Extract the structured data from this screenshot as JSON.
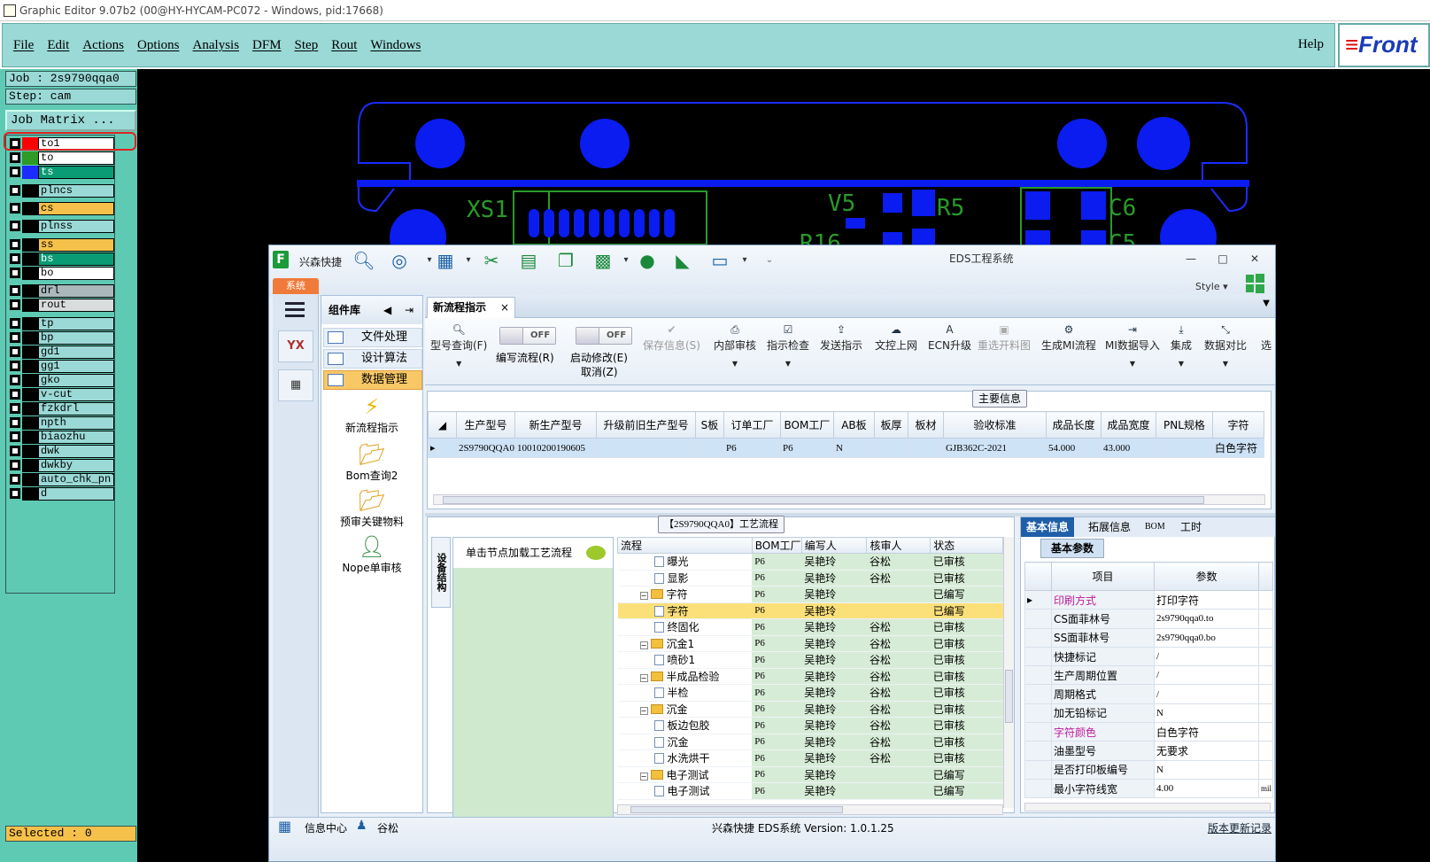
{
  "window": {
    "title": "Graphic Editor 9.07b2 (00@HY-HYCAM-PC072 - Windows, pid:17668)"
  },
  "menu": {
    "items": [
      "File",
      "Edit",
      "Actions",
      "Options",
      "Analysis",
      "DFM",
      "Step",
      "Rout",
      "Windows"
    ],
    "help": "Help",
    "logo": "Front"
  },
  "job": {
    "job_label": "Job : 2s9790qqa0",
    "step_label": "Step: cam",
    "matrix_button": "Job Matrix ...",
    "selected": "Selected : 0"
  },
  "layers": [
    {
      "name": "to1",
      "color": "#ff0000",
      "bg": "#ffffff"
    },
    {
      "name": "to",
      "color": "#2e9a28",
      "bg": "#ffffff"
    },
    {
      "name": "ts",
      "color": "#1a2cff",
      "bg": "#0a9b74"
    },
    {
      "name": "plncs",
      "color": "#000000",
      "bg": "#9ad9d6"
    },
    {
      "name": "cs",
      "color": "#000000",
      "bg": "#f6c14a"
    },
    {
      "name": "plnss",
      "color": "#000000",
      "bg": "#9ad9d6"
    },
    {
      "name": "ss",
      "color": "#000000",
      "bg": "#f6c14a"
    },
    {
      "name": "bs",
      "color": "#000000",
      "bg": "#0a9b74"
    },
    {
      "name": "bo",
      "color": "#000000",
      "bg": "#ffffff"
    },
    {
      "name": "drl",
      "color": "#000000",
      "bg": "#aab8bc"
    },
    {
      "name": "rout",
      "color": "#000000",
      "bg": "#d8dcdc"
    },
    {
      "name": "tp",
      "color": "#000000",
      "bg": "#9ad9d6"
    },
    {
      "name": "bp",
      "color": "#000000",
      "bg": "#9ad9d6"
    },
    {
      "name": "gd1",
      "color": "#000000",
      "bg": "#9ad9d6"
    },
    {
      "name": "gg1",
      "color": "#000000",
      "bg": "#9ad9d6"
    },
    {
      "name": "gko",
      "color": "#000000",
      "bg": "#9ad9d6"
    },
    {
      "name": "v-cut",
      "color": "#000000",
      "bg": "#9ad9d6"
    },
    {
      "name": "fzkdrl",
      "color": "#000000",
      "bg": "#9ad9d6"
    },
    {
      "name": "npth",
      "color": "#000000",
      "bg": "#9ad9d6"
    },
    {
      "name": "biaozhu",
      "color": "#000000",
      "bg": "#9ad9d6"
    },
    {
      "name": "dwk",
      "color": "#000000",
      "bg": "#9ad9d6"
    },
    {
      "name": "dwkby",
      "color": "#000000",
      "bg": "#9ad9d6"
    },
    {
      "name": "auto_chk_pnl",
      "color": "#000000",
      "bg": "#9ad9d6"
    },
    {
      "name": "d",
      "color": "#000000",
      "bg": "#9ad9d6"
    }
  ],
  "pcb": {
    "labels": [
      "XS1",
      "V5",
      "R5",
      "C6",
      "R16",
      "C5"
    ],
    "colors": {
      "pad": "#0a1cf0",
      "silk": "#2a9a2a",
      "outline": "#1a2cff"
    }
  },
  "eds": {
    "brand": "兴森快捷",
    "title": "EDS工程系统",
    "sys_tab": "系统",
    "style_label": "Style",
    "window_controls": [
      "—",
      "□",
      "✕"
    ],
    "nav_icons": [
      "menu-icon",
      "yx-icon",
      "calculator-icon"
    ],
    "component_lib": {
      "title": "组件库",
      "items": [
        "文件处理",
        "设计算法",
        "数据管理"
      ],
      "big": [
        {
          "label": "新流程指示",
          "icon": "⚡"
        },
        {
          "label": "Bom查询2",
          "icon": "📂"
        },
        {
          "label": "预审关键物料",
          "icon": "📂"
        },
        {
          "label": "Nope单审核",
          "icon": "👤"
        }
      ]
    },
    "tab": {
      "label": "新流程指示",
      "close": "×"
    },
    "ribbon": {
      "query": "型号查询(F)",
      "toggle1": {
        "state": "OFF",
        "label": "编写流程(R)"
      },
      "toggle2": {
        "state": "OFF",
        "label": "启动修改(E)",
        "sub": "取消(Z)"
      },
      "buttons": [
        "保存信息(S)",
        "内部审核",
        "指示检查",
        "发送指示",
        "文控上网",
        "ECN升级",
        "重选开料图",
        "生成MI流程",
        "MI数据导入",
        "集成",
        "数据对比",
        "选"
      ]
    },
    "main_info": {
      "caption": "主要信息",
      "headers": [
        "生产型号",
        "新生产型号",
        "升级前旧生产型号",
        "S板",
        "订单工厂",
        "BOM工厂",
        "AB板",
        "板厚",
        "板材",
        "验收标准",
        "成品长度",
        "成品宽度",
        "PNL规格",
        "字符"
      ],
      "row": [
        "2S9790QQA0",
        "10010200190605",
        "",
        "",
        "P6",
        "P6",
        "N",
        "",
        "",
        "GJB362C-2021",
        "54.000",
        "43.000",
        "",
        "白色字符"
      ]
    },
    "process": {
      "caption": "【2S9790QQA0】工艺流程",
      "vtab": "设备结构",
      "tip": "单击节点加载工艺流程",
      "headers": [
        "流程",
        "BOM工厂",
        "编写人",
        "核审人",
        "状态"
      ],
      "rows": [
        {
          "name": "曝光",
          "level": 2,
          "type": "file",
          "bom": "P6",
          "writer": "吴艳玲",
          "reviewer": "谷松",
          "status": "已审核"
        },
        {
          "name": "显影",
          "level": 2,
          "type": "file",
          "bom": "P6",
          "writer": "吴艳玲",
          "reviewer": "谷松",
          "status": "已审核"
        },
        {
          "name": "字符",
          "level": 1,
          "type": "folder",
          "bom": "P6",
          "writer": "吴艳玲",
          "reviewer": "",
          "status": "已编写"
        },
        {
          "name": "字符",
          "level": 2,
          "type": "file",
          "bom": "P6",
          "writer": "吴艳玲",
          "reviewer": "",
          "status": "已编写",
          "highlight": true
        },
        {
          "name": "终固化",
          "level": 2,
          "type": "file",
          "bom": "P6",
          "writer": "吴艳玲",
          "reviewer": "谷松",
          "status": "已审核"
        },
        {
          "name": "沉金1",
          "level": 1,
          "type": "folder",
          "bom": "P6",
          "writer": "吴艳玲",
          "reviewer": "谷松",
          "status": "已审核"
        },
        {
          "name": "喷砂1",
          "level": 2,
          "type": "file",
          "bom": "P6",
          "writer": "吴艳玲",
          "reviewer": "谷松",
          "status": "已审核"
        },
        {
          "name": "半成品检验",
          "level": 1,
          "type": "folder",
          "bom": "P6",
          "writer": "吴艳玲",
          "reviewer": "谷松",
          "status": "已审核"
        },
        {
          "name": "半检",
          "level": 2,
          "type": "file",
          "bom": "P6",
          "writer": "吴艳玲",
          "reviewer": "谷松",
          "status": "已审核"
        },
        {
          "name": "沉金",
          "level": 1,
          "type": "folder",
          "bom": "P6",
          "writer": "吴艳玲",
          "reviewer": "谷松",
          "status": "已审核"
        },
        {
          "name": "板边包胶",
          "level": 2,
          "type": "file",
          "bom": "P6",
          "writer": "吴艳玲",
          "reviewer": "谷松",
          "status": "已审核"
        },
        {
          "name": "沉金",
          "level": 2,
          "type": "file",
          "bom": "P6",
          "writer": "吴艳玲",
          "reviewer": "谷松",
          "status": "已审核"
        },
        {
          "name": "水洗烘干",
          "level": 2,
          "type": "file",
          "bom": "P6",
          "writer": "吴艳玲",
          "reviewer": "谷松",
          "status": "已审核"
        },
        {
          "name": "电子测试",
          "level": 1,
          "type": "folder",
          "bom": "P6",
          "writer": "吴艳玲",
          "reviewer": "",
          "status": "已编写"
        },
        {
          "name": "电子测试",
          "level": 2,
          "type": "file",
          "bom": "P6",
          "writer": "吴艳玲",
          "reviewer": "",
          "status": "已编写"
        }
      ]
    },
    "basic": {
      "tabs": [
        "基本信息",
        "拓展信息",
        "BOM",
        "工时"
      ],
      "sub_tab": "基本参数",
      "headers": [
        "项目",
        "参数"
      ],
      "rows": [
        {
          "k": "印刷方式",
          "v": "打印字符",
          "pink": true
        },
        {
          "k": "CS面菲林号",
          "v": "2s9790qqa0.to"
        },
        {
          "k": "SS面菲林号",
          "v": "2s9790qqa0.bo"
        },
        {
          "k": "快捷标记",
          "v": "/"
        },
        {
          "k": "生产周期位置",
          "v": "/"
        },
        {
          "k": "周期格式",
          "v": "/"
        },
        {
          "k": "加无铅标记",
          "v": "N"
        },
        {
          "k": "字符颜色",
          "v": "白色字符",
          "pink": true
        },
        {
          "k": "油墨型号",
          "v": "无要求"
        },
        {
          "k": "是否打印板编号",
          "v": "N"
        },
        {
          "k": "最小字符线宽",
          "v": "4.00"
        }
      ],
      "unit": "mil"
    },
    "status": {
      "info_center": "信息中心",
      "user": "谷松",
      "version": "兴森快捷 EDS系统 Version: 1.0.1.25",
      "update_log": "版本更新记录"
    }
  }
}
